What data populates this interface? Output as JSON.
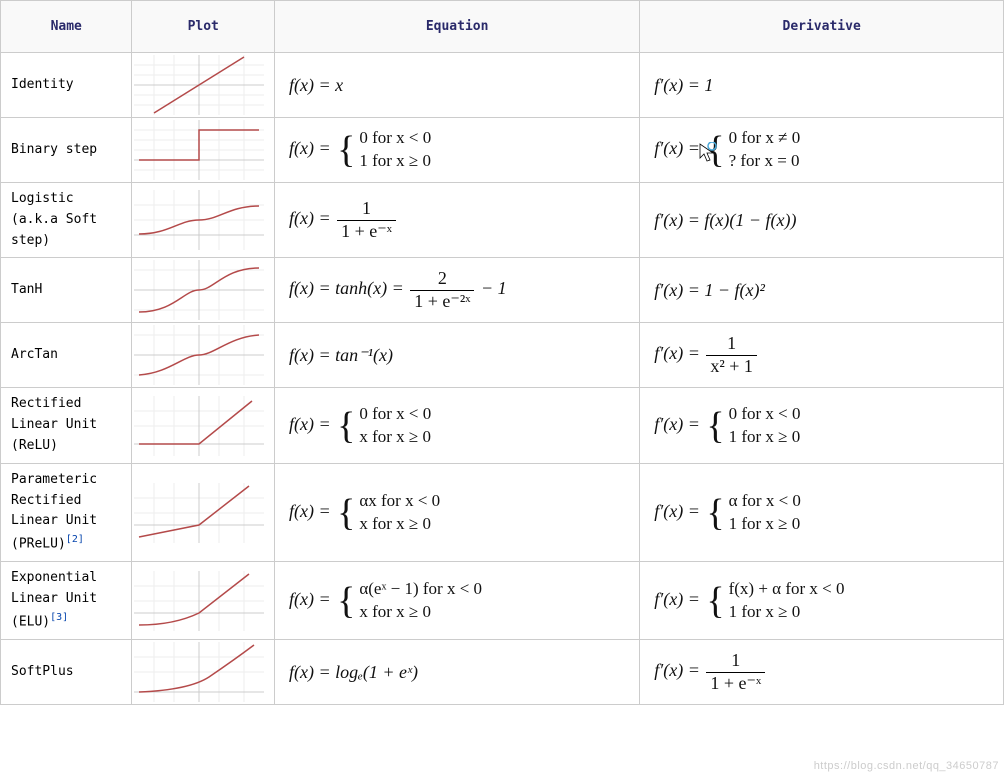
{
  "headers": {
    "name": "Name",
    "plot": "Plot",
    "equation": "Equation",
    "derivative": "Derivative"
  },
  "rows": {
    "identity": {
      "name": "Identity",
      "equation": "f(x) = x",
      "derivative": "f′(x) = 1"
    },
    "binary_step": {
      "name": "Binary step",
      "eq_prefix": "f(x) = ",
      "eq_case1": "0   for   x < 0",
      "eq_case2": "1   for   x ≥ 0",
      "der_prefix": "f′(x) = ",
      "der_case1": "0   for   x ≠ 0",
      "der_case2": "?   for   x = 0"
    },
    "logistic": {
      "name": "Logistic (a.k.a Soft step)",
      "eq_prefix": "f(x) = ",
      "eq_num": "1",
      "eq_den": "1 + e⁻ˣ",
      "derivative": "f′(x) = f(x)(1 − f(x))"
    },
    "tanh": {
      "name": "TanH",
      "eq_prefix": "f(x) = tanh(x) = ",
      "eq_num": "2",
      "eq_den": "1 + e⁻²ˣ",
      "eq_suffix": " − 1",
      "derivative": "f′(x) = 1 − f(x)²"
    },
    "arctan": {
      "name": "ArcTan",
      "equation": "f(x) = tan⁻¹(x)",
      "der_prefix": "f′(x) = ",
      "der_num": "1",
      "der_den": "x² + 1"
    },
    "relu": {
      "name": "Rectified Linear Unit (ReLU)",
      "eq_prefix": "f(x) = ",
      "eq_case1": "0   for   x < 0",
      "eq_case2": "x   for   x ≥ 0",
      "der_prefix": "f′(x) = ",
      "der_case1": "0   for   x < 0",
      "der_case2": "1   for   x ≥ 0"
    },
    "prelu": {
      "name_line1": "Parameteric",
      "name_line2": "Rectified",
      "name_line3": "Linear Unit",
      "name_line4": "(PReLU)",
      "ref": "[2]",
      "eq_prefix": "f(x) = ",
      "eq_case1": "αx   for   x < 0",
      "eq_case2": "  x   for   x ≥ 0",
      "der_prefix": "f′(x) = ",
      "der_case1": "α   for   x < 0",
      "der_case2": "1   for   x ≥ 0"
    },
    "elu": {
      "name_line1": "Exponential",
      "name_line2": "Linear Unit",
      "name_line3": "(ELU)",
      "ref": "[3]",
      "eq_prefix": "f(x) = ",
      "eq_case1": "α(eˣ − 1)   for   x < 0",
      "eq_case2": "            x   for   x ≥ 0",
      "der_prefix": "f′(x) = ",
      "der_case1": "f(x) + α   for   x < 0",
      "der_case2": "            1   for   x ≥ 0"
    },
    "softplus": {
      "name": "SoftPlus",
      "equation": "f(x) = logₑ(1 + eˣ)",
      "der_prefix": "f′(x) = ",
      "der_num": "1",
      "der_den": "1 + e⁻ˣ"
    }
  },
  "watermark": "https://blog.csdn.net/qq_34650787",
  "colors": {
    "grid": "#eeeeee",
    "axis": "#cccccc",
    "curve": "#b44a4a"
  },
  "chart_data": [
    {
      "name": "Identity",
      "type": "line",
      "x_range": [
        -3,
        3
      ],
      "y_range": [
        -1.5,
        1.5
      ],
      "segments": [
        [
          [
            -3,
            -1.5
          ],
          [
            3,
            1.5
          ]
        ]
      ]
    },
    {
      "name": "Binary step",
      "type": "line",
      "x_range": [
        -3,
        3
      ],
      "y_range": [
        -0.2,
        1.2
      ],
      "segments": [
        [
          [
            -3,
            0
          ],
          [
            0,
            0
          ]
        ],
        [
          [
            0,
            1
          ],
          [
            3,
            1
          ]
        ]
      ]
    },
    {
      "name": "Logistic",
      "type": "line",
      "x_range": [
        -6,
        6
      ],
      "y_range": [
        0,
        1
      ],
      "formula": "1/(1+e^-x)"
    },
    {
      "name": "TanH",
      "type": "line",
      "x_range": [
        -3,
        3
      ],
      "y_range": [
        -1,
        1
      ],
      "formula": "tanh(x)"
    },
    {
      "name": "ArcTan",
      "type": "line",
      "x_range": [
        -6,
        6
      ],
      "y_range": [
        -1.6,
        1.6
      ],
      "formula": "atan(x)"
    },
    {
      "name": "ReLU",
      "type": "line",
      "x_range": [
        -3,
        3
      ],
      "y_range": [
        -0.5,
        3
      ],
      "segments": [
        [
          [
            -3,
            0
          ],
          [
            0,
            0
          ]
        ],
        [
          [
            0,
            0
          ],
          [
            3,
            3
          ]
        ]
      ]
    },
    {
      "name": "PReLU",
      "type": "line",
      "x_range": [
        -3,
        3
      ],
      "y_range": [
        -1,
        3
      ],
      "segments": [
        [
          [
            -3,
            -0.75
          ],
          [
            0,
            0
          ]
        ],
        [
          [
            0,
            0
          ],
          [
            3,
            3
          ]
        ]
      ]
    },
    {
      "name": "ELU",
      "type": "line",
      "x_range": [
        -3,
        3
      ],
      "y_range": [
        -1.2,
        3
      ],
      "formula_piecewise": {
        "neg": "alpha*(e^x-1)",
        "pos": "x"
      }
    },
    {
      "name": "SoftPlus",
      "type": "line",
      "x_range": [
        -4,
        4
      ],
      "y_range": [
        0,
        4
      ],
      "formula": "ln(1+e^x)"
    }
  ]
}
